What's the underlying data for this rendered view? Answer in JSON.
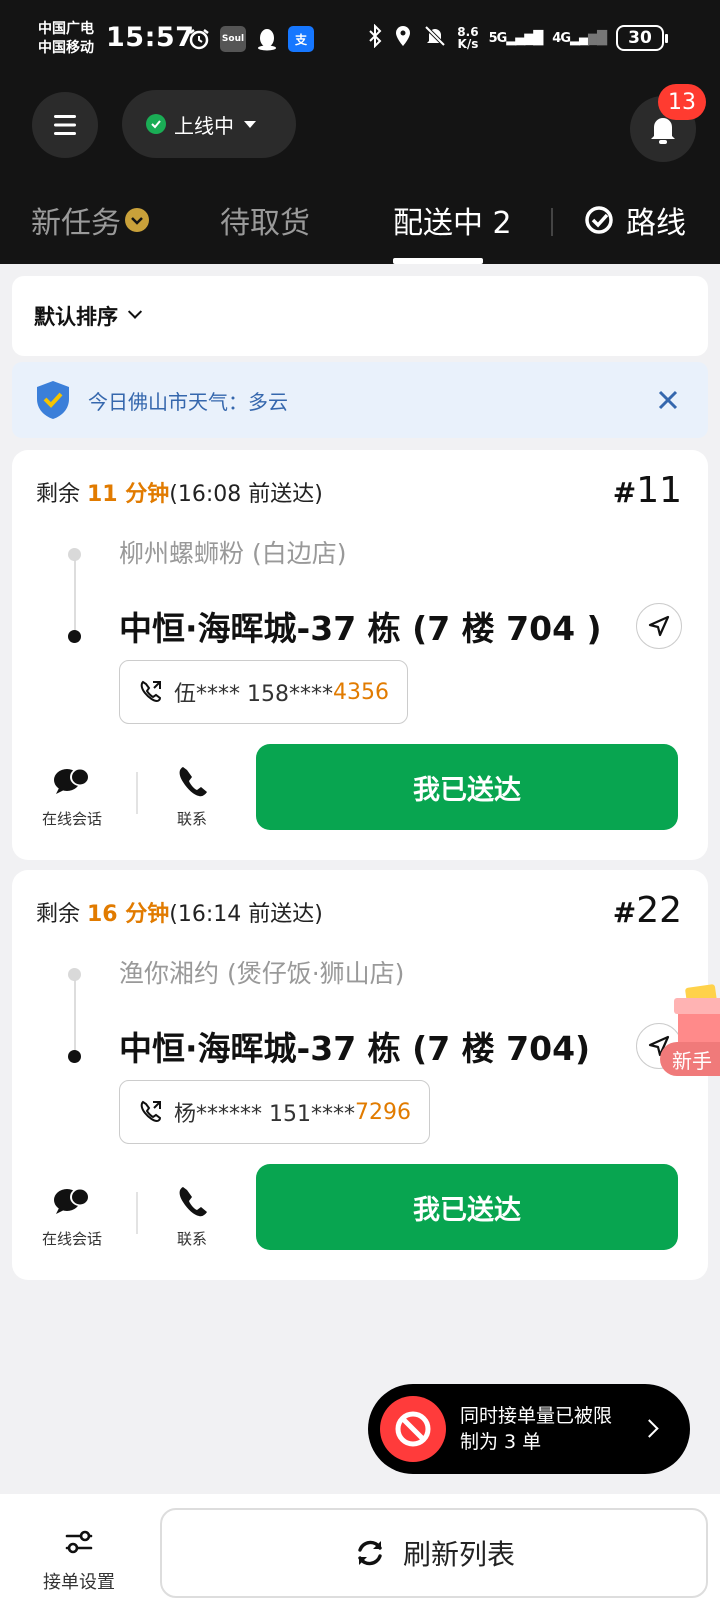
{
  "status_bar": {
    "carrier_1": "中国广电",
    "carrier_2": "中国移动",
    "time": "15:57",
    "app_icon_soul": "Soul",
    "app_icon_alipay": "支",
    "speed_value": "8.6",
    "speed_unit": "K/s",
    "signal_1": "5G",
    "signal_2": "4G",
    "battery": "30"
  },
  "header": {
    "online_status": "上线中",
    "notification_count": "13"
  },
  "tabs": [
    {
      "label": "新任务"
    },
    {
      "label": "待取货"
    },
    {
      "label": "配送中 2"
    },
    {
      "label": "路线"
    }
  ],
  "sort": {
    "label": "默认排序"
  },
  "weather_banner": {
    "text": "今日佛山市天气：多云"
  },
  "orders": [
    {
      "remain_prefix": "剩余 ",
      "remain_minutes": "11 分钟",
      "deadline": "(16:08 前送达)",
      "order_number": "11",
      "shop": "柳州螺蛳粉 (白边店)",
      "address": "中恒·海晖城-37 栋 (7 楼 704 )",
      "phone_masked": "伍**** 158****",
      "phone_tail": "4356",
      "chat_label": "在线会话",
      "contact_label": "联系",
      "deliver_label": "我已送达"
    },
    {
      "remain_prefix": "剩余 ",
      "remain_minutes": "16 分钟",
      "deadline": "(16:14 前送达)",
      "order_number": "22",
      "shop": "渔你湘约 (煲仔饭·狮山店)",
      "address": "中恒·海晖城-37 栋 (7 楼 704)",
      "phone_masked": "杨****** 151****",
      "phone_tail": "7296",
      "chat_label": "在线会话",
      "contact_label": "联系",
      "deliver_label": "我已送达"
    }
  ],
  "gift": {
    "label": "新手"
  },
  "toast": {
    "text": "同时接单量已被限制为 3 单"
  },
  "bottom": {
    "settings_label": "接单设置",
    "refresh_label": "刷新列表"
  },
  "colors": {
    "accent_green": "#08a550",
    "orange": "#e17b00",
    "badge_red": "#ff3b30"
  }
}
